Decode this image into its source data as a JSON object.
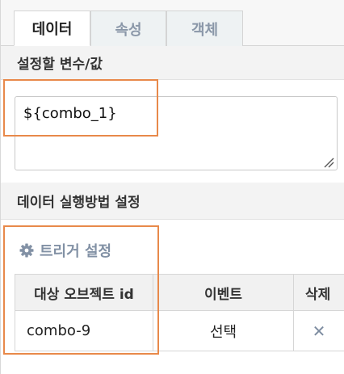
{
  "tabs": [
    {
      "label": "데이터",
      "active": true
    },
    {
      "label": "속성",
      "active": false
    },
    {
      "label": "객체",
      "active": false
    }
  ],
  "variable_section": {
    "title": "설정할 변수/값",
    "value": "${combo_1}"
  },
  "execution_section": {
    "title": "데이터 실행방법 설정"
  },
  "trigger": {
    "title": "트리거 설정",
    "icon": "gear-icon",
    "columns": [
      "대상 오브젝트 id",
      "이벤트",
      "삭제"
    ],
    "rows": [
      {
        "object_id": "combo-9",
        "event": "선택",
        "delete": "✕"
      }
    ]
  },
  "colors": {
    "highlight": "#e8894a",
    "inactive_tab_text": "#8a97a8",
    "trigger_text": "#8291a5"
  }
}
